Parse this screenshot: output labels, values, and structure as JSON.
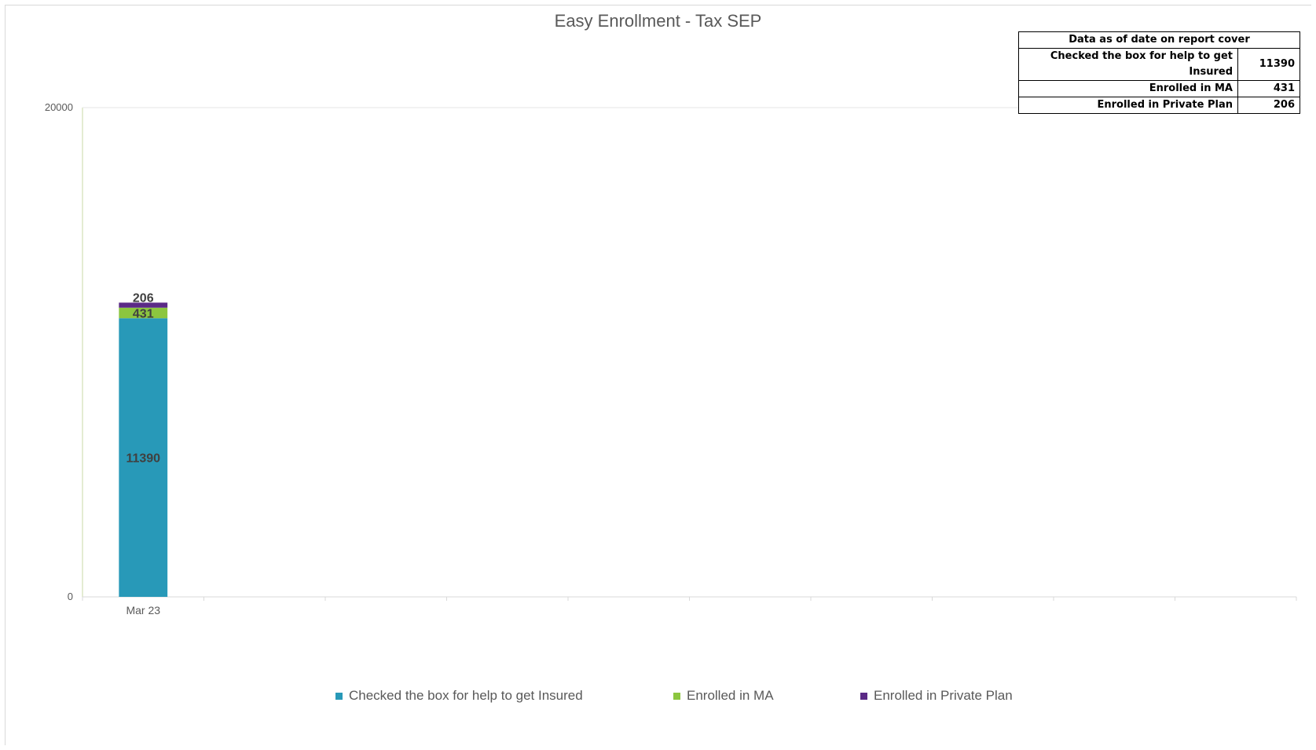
{
  "chart_data": {
    "type": "bar",
    "stacked": true,
    "title": "Easy Enrollment - Tax SEP",
    "xlabel": "",
    "ylabel": "",
    "ylim": [
      0,
      20000
    ],
    "yticks": [
      "0",
      "20000"
    ],
    "categories": [
      "Mar 23",
      "",
      "",
      "",
      "",
      "",
      "",
      "",
      "",
      ""
    ],
    "series": [
      {
        "name": "Checked the box for help to get Insured",
        "color": "#2899b8",
        "values": [
          11390
        ]
      },
      {
        "name": "Enrolled in MA",
        "color": "#8cc63f",
        "values": [
          431
        ]
      },
      {
        "name": "Enrolled in Private Plan",
        "color": "#5b2a86",
        "values": [
          206
        ]
      }
    ],
    "grid": false,
    "legend_position": "bottom"
  },
  "summary_table": {
    "header": "Data as of date on report cover",
    "rows": [
      {
        "label": "Checked the box for help to get Insured",
        "value": "11390"
      },
      {
        "label": "Enrolled in MA",
        "value": "431"
      },
      {
        "label": "Enrolled in Private Plan",
        "value": "206"
      }
    ]
  }
}
